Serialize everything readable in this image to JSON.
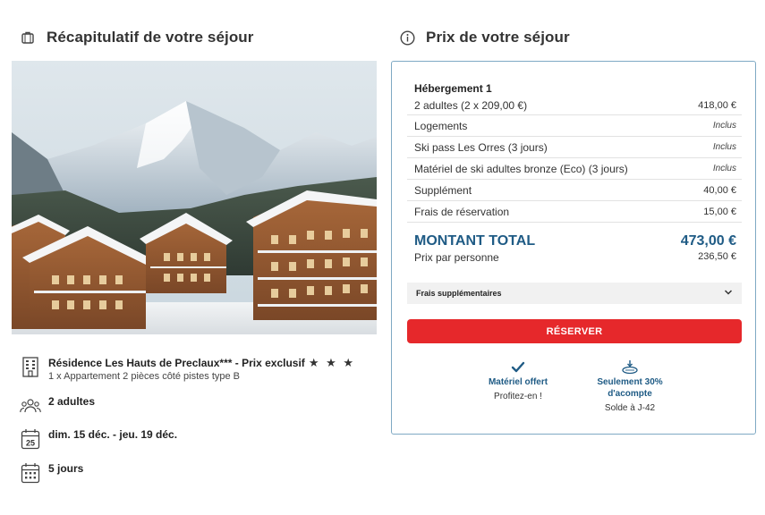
{
  "left": {
    "title": "Récapitulatif de votre séjour",
    "residence": "Résidence Les Hauts de Preclaux*** - Prix exclusif",
    "residence_stars": "★ ★ ★",
    "apartment": "1 x Appartement 2 pièces côté pistes type B",
    "guests": "2 adultes",
    "dates": "dim. 15 déc. - jeu. 19 déc.",
    "calendar_day": "25",
    "duration": "5 jours"
  },
  "right": {
    "title": "Prix de votre séjour",
    "hebergement_title": "Hébergement 1",
    "rows": [
      {
        "label": "2 adultes (2 x 209,00 €)",
        "value": "418,00 €",
        "included": false
      },
      {
        "label": "Logements",
        "value": "Inclus",
        "included": true
      },
      {
        "label": "Ski pass Les Orres (3 jours)",
        "value": "Inclus",
        "included": true
      },
      {
        "label": "Matériel de ski adultes bronze (Eco) (3 jours)",
        "value": "Inclus",
        "included": true
      },
      {
        "label": "Supplément",
        "value": "40,00 €",
        "included": false
      },
      {
        "label": "Frais de réservation",
        "value": "15,00 €",
        "included": false
      }
    ],
    "total_label": "MONTANT TOTAL",
    "total_value": "473,00 €",
    "per_person_label": "Prix par personne",
    "per_person_value": "236,50 €",
    "extras_label": "Frais supplémentaires",
    "reserve_label": "RÉSERVER",
    "perks": [
      {
        "title": "Matériel offert",
        "subtitle": "Profitez-en !"
      },
      {
        "title": "Seulement 30% d'acompte",
        "subtitle": "Solde à J-42"
      }
    ]
  },
  "colors": {
    "accent_blue": "#1f5b85",
    "reserve_red": "#e6282b",
    "panel_border": "#7fa9c4"
  }
}
